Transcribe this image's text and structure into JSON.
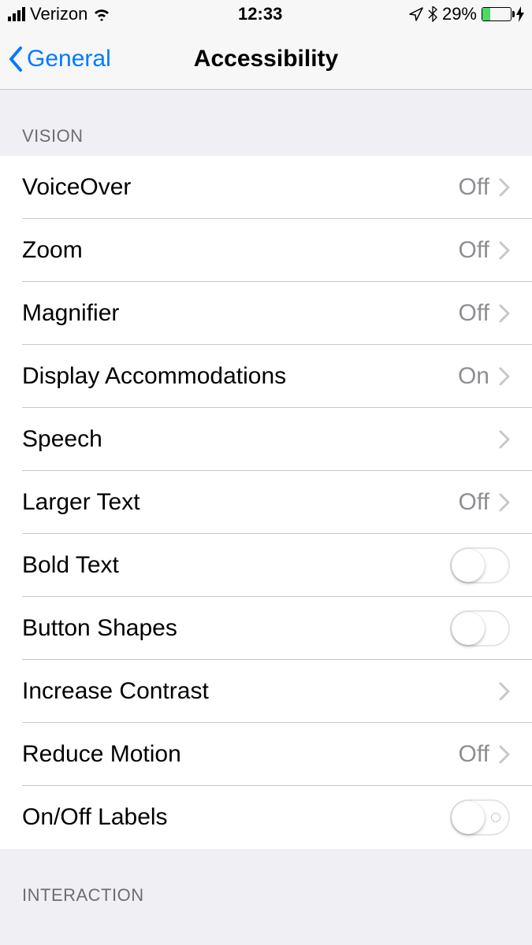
{
  "status_bar": {
    "carrier": "Verizon",
    "time": "12:33",
    "battery_percent": "29%"
  },
  "nav": {
    "back_label": "General",
    "title": "Accessibility"
  },
  "sections": {
    "vision_header": "VISION",
    "interaction_header": "INTERACTION",
    "rows": {
      "voiceover": {
        "label": "VoiceOver",
        "value": "Off"
      },
      "zoom": {
        "label": "Zoom",
        "value": "Off"
      },
      "magnifier": {
        "label": "Magnifier",
        "value": "Off"
      },
      "display_accommodations": {
        "label": "Display Accommodations",
        "value": "On"
      },
      "speech": {
        "label": "Speech"
      },
      "larger_text": {
        "label": "Larger Text",
        "value": "Off"
      },
      "bold_text": {
        "label": "Bold Text"
      },
      "button_shapes": {
        "label": "Button Shapes"
      },
      "increase_contrast": {
        "label": "Increase Contrast"
      },
      "reduce_motion": {
        "label": "Reduce Motion",
        "value": "Off"
      },
      "onoff_labels": {
        "label": "On/Off Labels"
      }
    }
  }
}
